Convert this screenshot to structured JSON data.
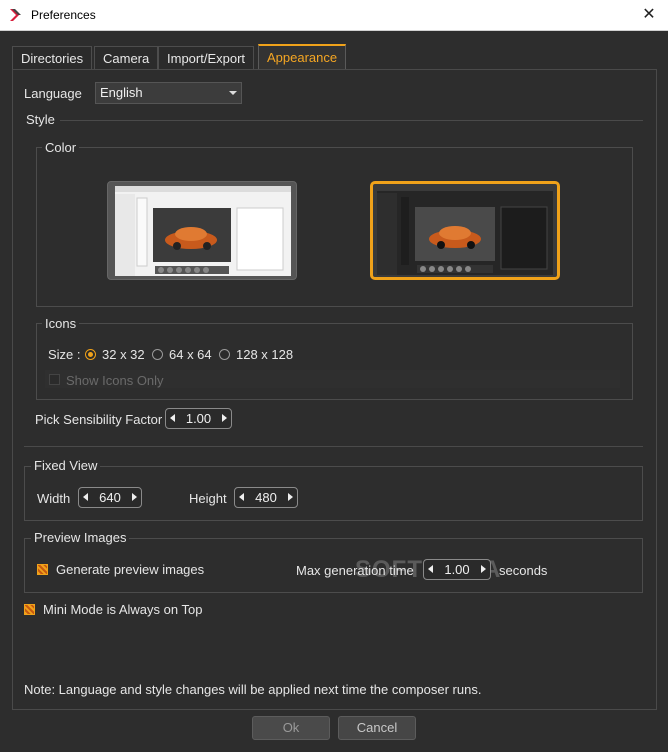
{
  "window": {
    "title": "Preferences",
    "close_glyph": "✕"
  },
  "tabs": [
    {
      "label": "Directories",
      "active": false
    },
    {
      "label": "Camera",
      "active": false
    },
    {
      "label": "Import/Export",
      "active": false
    },
    {
      "label": "Appearance",
      "active": true
    }
  ],
  "language": {
    "label": "Language",
    "value": "English"
  },
  "style": {
    "label": "Style",
    "color": {
      "label": "Color",
      "options": [
        "light-theme-preview",
        "dark-theme-preview"
      ],
      "selected": "dark-theme-preview"
    },
    "icons": {
      "label": "Icons",
      "size_label": "Size :",
      "sizes": [
        "32 x 32",
        "64 x 64",
        "128 x 128"
      ],
      "selected": "32 x 32",
      "show_icons_only": {
        "label": "Show Icons Only",
        "checked": false,
        "enabled": false
      }
    },
    "pick_sensibility": {
      "label": "Pick Sensibility Factor",
      "value": "1.00"
    }
  },
  "fixed_view": {
    "label": "Fixed View",
    "width": {
      "label": "Width",
      "value": "640"
    },
    "height": {
      "label": "Height",
      "value": "480"
    }
  },
  "preview_images": {
    "label": "Preview Images",
    "generate": {
      "label": "Generate preview images",
      "checked": true
    },
    "max_time": {
      "label": "Max generation time",
      "value": "1.00",
      "unit": "seconds"
    }
  },
  "mini_mode": {
    "label": "Mini Mode is Always on Top",
    "checked": true
  },
  "note": "Note: Language and style changes will be applied next time the composer runs.",
  "buttons": {
    "ok": "Ok",
    "cancel": "Cancel"
  },
  "watermark": "SOFTPEDIA",
  "colors": {
    "accent": "#f0a21a",
    "background": "#2d2d2d"
  }
}
